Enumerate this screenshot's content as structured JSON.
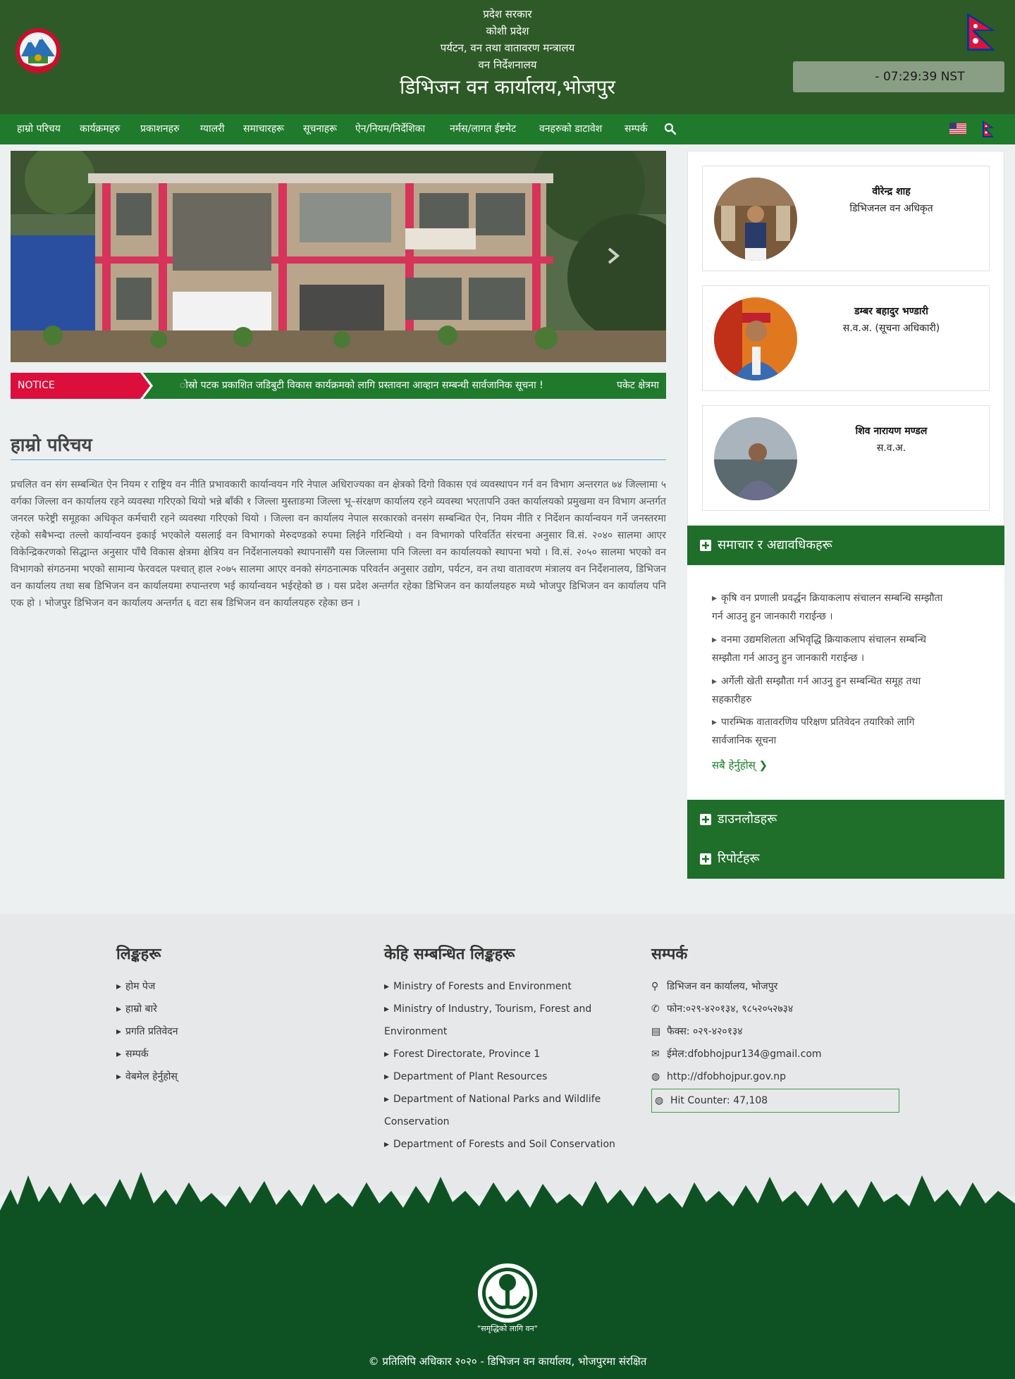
{
  "header": {
    "line1": "प्रदेश सरकार",
    "line2": "कोशी प्रदेश",
    "line3": "पर्यटन, वन तथा वातावरण मन्त्रालय",
    "line4": "वन निर्देशनालय",
    "title": "डिभिजन वन कार्यालय,भोजपुर",
    "clock": "- 07:29:39 NST"
  },
  "nav": {
    "items": [
      "हाम्रो परिचय",
      "कार्यक्रमहरु",
      "प्रकाशनहरु",
      "ग्यालरी",
      "समाचारहरू",
      "सूचनाहरू",
      "ऐन/नियम/निर्देशिका",
      "नर्मस/लागत ईष्टमेट",
      "वनहरुको डाटावेश",
      "सम्पर्क"
    ]
  },
  "notice": {
    "label": "NOTICE",
    "text": "ोस्रो पटक प्रकाशित जडिबुटी विकास कार्यक्रमको लागि प्रस्तावना आव्हान सम्बन्धी सार्वजानिक सूचना !",
    "text2": "पकेट क्षेत्रमा"
  },
  "about": {
    "title": "हाम्रो परिचय",
    "body": "प्रचलित वन संग सम्बन्धित ऐन नियम र राष्ट्रिय वन नीति प्रभावकारी कार्यान्वयन गरि नेपाल अधिराज्यका वन क्षेत्रको दिगो विकास एवं व्यवस्थापन गर्न वन विभाग अन्तरगत ७४ जिल्लामा ५ वर्गका जिल्ला वन कार्यालय रहने व्यवस्था गरिएको थियो भन्ने बाँकी १ जिल्ला मुस्ताङमा जिल्ला भू–संरक्षण कार्यालय रहने व्यवस्था भएतापनि उक्त कार्यालयको प्रमुखमा वन विभाग अन्तर्गत जनरल फरेष्ट्री समूहका अधिकृत कर्मचारी रहने व्यवस्था गरिएको थियो । जिल्ला वन कार्यालय नेपाल सरकारको वनसंग सम्बन्धित ऐन, नियम नीति र निर्देशन कार्यान्वयन गर्ने जनस्तरमा रहेको सबैभन्दा तल्लो कार्यान्वयन इकाई भएकोले यसलाई वन विभागको मेरुदण्डको रुपमा लिईने गरिन्थियो । वन विभागको परिवर्तित संरचना अनुसार वि.सं. २०४० सालमा आएर विकेन्द्रिकरणको सिद्धान्त अनुसार पाँचै विकास क्षेत्रमा क्षेत्रिय वन निर्देशनालयको स्थापनासँगै यस जिल्लामा पनि जिल्ला वन कार्यालयको स्थापना भयो । वि.सं. २०५० सालमा भएको वन विभागको संगठनमा भएको सामान्य फेरवदल पश्चात् हाल २०७५ सालमा आएर वनको संगठनात्मक परिवर्तन अनुसार उद्योग, पर्यटन, वन तथा वातावरण मंत्रालय वन निर्देशनालय, डिभिजन वन कार्यालय तथा सब डिभिजन वन कार्यालयमा रुपान्तरण भई कार्यान्वयन भईरहेको छ । यस प्रदेश अन्तर्गत रहेका डिभिजन वन कार्यालयहरु मध्ये भोजपुर डिभिजन वन कार्यालय पनि एक हो । भोजपुर डिभिजन वन कार्यालय अन्तर्गत ६ वटा सब डिभिजन वन कार्यालयहरु रहेका छन ।"
  },
  "officers": [
    {
      "name": "वीरेन्द्र शाह",
      "role": "डिभिजनल वन अधिकृत"
    },
    {
      "name": "डम्बर बहादुर भण्डारी",
      "role": "स.व.अ. (सूचना अधिकारी)"
    },
    {
      "name": "शिव नारायण मण्डल",
      "role": "स.व.अ."
    }
  ],
  "news": {
    "title": "समाचार र अद्यावधिकहरू",
    "items": [
      [
        "कृषि वन प्रणाली प्रवर्द्धन क्रियाकलाप संचालन सम्बन्धि सम्झौता",
        "गर्न आउनु हुन जानकारी गराईन्छ ।"
      ],
      [
        "वनमा उद्यमशिलता अभिवृद्धि क्रियाकलाप संचालन सम्बन्धि",
        "सम्झौता गर्न आउनु हुन जानकारी गराईन्छ ।"
      ],
      [
        "अर्गेली खेती सम्झौता गर्न आउनु हुन सम्बन्धित समूह तथा",
        "सहकारीहरु"
      ],
      [
        "पारम्भिक वातावरणिय परिक्षण प्रतिवेदन तयारिको लागि",
        "सार्वजानिक सूचना"
      ]
    ],
    "view_all": "सबै हेर्नुहोस्"
  },
  "downloads_title": "डाउनलोडहरू",
  "reports_title": "रिपोर्टहरू",
  "footer": {
    "links_title": "लिङ्कहरू",
    "links": [
      "होम पेज",
      "हाम्रो बारे",
      "प्रगति प्रतिवेदन",
      "सम्पर्क",
      "वेबमेल हेर्नुहोस्"
    ],
    "related_title": "केहि सम्बन्धित लिङ्कहरू",
    "related": [
      "Ministry of Forests and Environment",
      "Ministry of Industry, Tourism, Forest and",
      "Environment",
      "Forest Directorate, Province 1",
      "Department of Plant Resources",
      "Department of National Parks and Wildlife",
      "Conservation",
      "Department of Forests and Soil Conservation"
    ],
    "contact_title": "सम्पर्क",
    "address": "डिभिजन वन कार्यालय, भोजपुर",
    "phone": "फोन:०२९-४२०१३४, ९८५२०५२७३४",
    "fax": "फैक्स: ०२९-४२०१३४",
    "email": "ईमेल:dfobhojpur134@gmail.com",
    "web": "http://dfobhojpur.gov.np",
    "hit_counter": "Hit Counter: 47,108"
  },
  "bottom": {
    "slogan": "\"समृद्धिको लागि वन\"",
    "copyright": "© प्रतिलिपि अधिकार २०२० - डिभिजन वन कार्यालय, भोजपुरमा संरक्षित"
  },
  "colors": {
    "header_green": "#2e5a27",
    "nav_green": "#1f7a2c",
    "notice_red": "#dc0e3c",
    "bottom_green": "#0e5224"
  }
}
